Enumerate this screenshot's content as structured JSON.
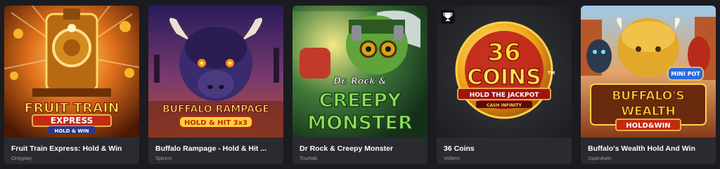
{
  "games": [
    {
      "title": "Fruit Train Express: Hold & Win",
      "provider": "Onlyplay",
      "art": {
        "line1": "FRUIT TRAIN",
        "line2": "EXPRESS",
        "line3": "HOLD & WIN"
      }
    },
    {
      "title": "Buffalo Rampage - Hold & Hit ...",
      "provider": "Spinmi",
      "art": {
        "line1": "BUFFALO RAMPAGE",
        "line2": "HOLD & HIT 3x3"
      }
    },
    {
      "title": "Dr Rock & Creepy Monster",
      "provider": "Truelab",
      "art": {
        "line1": "Dr. Rock &",
        "line2": "CREEPY",
        "line3": "MONSTER"
      }
    },
    {
      "title": "36 Coins",
      "provider": "Voltent",
      "art": {
        "line1": "36",
        "line2": "COINS",
        "line3": "HOLD THE JACKPOT",
        "line4": "CASH INFINITY",
        "tm": "TM"
      }
    },
    {
      "title": "Buffalo's Wealth Hold And Win",
      "provider": "1spin4win",
      "art": {
        "badge": "MINI POT",
        "line1": "BUFFALO'S",
        "line2": "WEALTH",
        "line3": "HOLD&WIN"
      }
    }
  ],
  "icons": {
    "trophy": "trophy-icon"
  },
  "colors": {
    "background": "#1b1c20",
    "card": "#2a2b30",
    "title": "#ffffff",
    "provider": "#9a9ba3"
  }
}
